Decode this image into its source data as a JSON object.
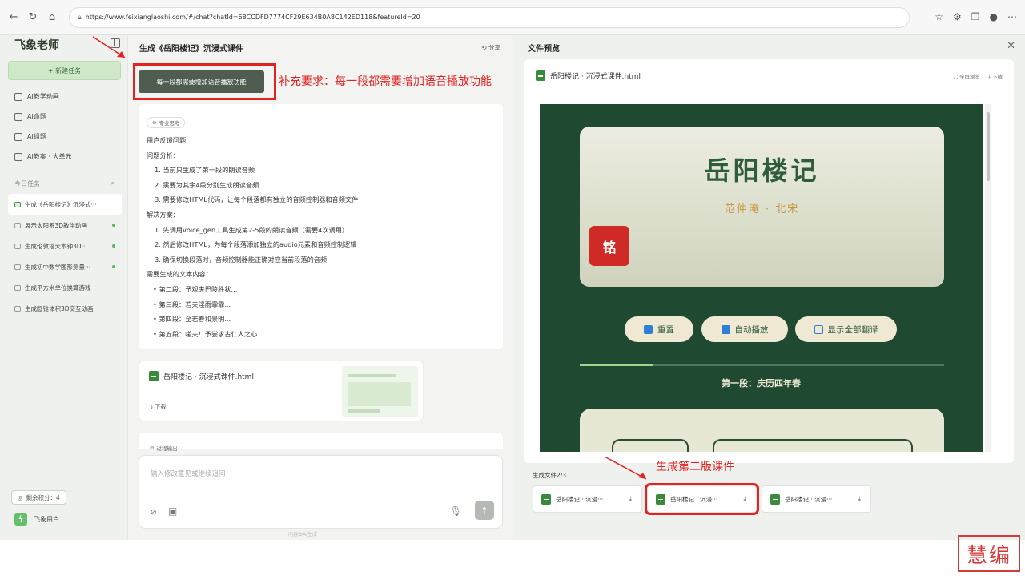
{
  "browser": {
    "url": "https://www.feixianglaoshi.com/#/chat?chatId=68CCDFD7774CF29E634B0A8C142ED118&featureId=20"
  },
  "sidebar": {
    "logo": "飞象老师",
    "new_task": "+ 新建任务",
    "menu": [
      {
        "label": "AI教学动画"
      },
      {
        "label": "AI命题"
      },
      {
        "label": "AI组题"
      },
      {
        "label": "AI教案 · 大单元"
      }
    ],
    "today_label": "今日任务",
    "tasks": [
      {
        "label": "生成《岳阳楼记》沉浸式···",
        "active": true
      },
      {
        "label": "展示太阳系3D教学动画",
        "dot": true
      },
      {
        "label": "生成伦敦塔大本钟3D···",
        "dot": true
      },
      {
        "label": "生成初中数学图形测量···",
        "dot": true
      },
      {
        "label": "生成平方米单位换算游戏"
      },
      {
        "label": "生成圆锥体积3D交互动画"
      }
    ],
    "points": "剩余积分：4",
    "user": "飞象用户"
  },
  "chat": {
    "title": "生成《岳阳楼记》沉浸式课件",
    "share": "分享",
    "user_msg": "每一段都需要增加语音播放功能",
    "annotation_top": "补充要求：每一段都需要增加语音播放功能",
    "thinking_label": "专业思考",
    "lines": [
      {
        "text": "用户反馈问题",
        "cls": ""
      },
      {
        "text": "问题分析：",
        "cls": ""
      },
      {
        "text": "1. 当前只生成了第一段的朗读音频",
        "cls": "ind"
      },
      {
        "text": "2. 需要为其余4段分别生成朗读音频",
        "cls": "ind"
      },
      {
        "text": "3. 需要修改HTML代码，让每个段落都有独立的音频控制器和音频文件",
        "cls": "ind"
      },
      {
        "text": "解决方案：",
        "cls": ""
      },
      {
        "text": "1. 先调用voice_gen工具生成第2-5段的朗读音频（需要4次调用）",
        "cls": "ind"
      },
      {
        "text": "2. 然后修改HTML，为每个段落添加独立的audio元素和音频控制逻辑",
        "cls": "ind"
      },
      {
        "text": "3. 确保切换段落时，音频控制器能正确对应当前段落的音频",
        "cls": "ind"
      },
      {
        "text": "需要生成的文本内容：",
        "cls": ""
      },
      {
        "text": "第二段：予观夫巴陵胜状...",
        "cls": "bul"
      },
      {
        "text": "第三段：若夫淫雨霏霏...",
        "cls": "bul"
      },
      {
        "text": "第四段：至若春和景明...",
        "cls": "bul"
      },
      {
        "text": "第五段：嗟夫！予尝求古仁人之心...",
        "cls": "bul"
      }
    ],
    "file_name": "岳阳楼记 · 沉浸式课件.html",
    "download": "下载",
    "process_label": "过程输出",
    "input_placeholder": "输入修改意见或继续追问",
    "ai_note": "内容由AI生成"
  },
  "preview": {
    "title": "文件预览",
    "file_name": "岳阳楼记 · 沉浸式课件.html",
    "fullscreen": "全屏浏览",
    "download": "下载",
    "hero_title": "岳阳楼记",
    "hero_sub": "范仲淹 · 北宋",
    "seal": "铭",
    "controls": {
      "reset": "重置",
      "autoplay": "自动播放",
      "translate": "显示全部翻译"
    },
    "progress": 0.2,
    "segment_title": "第一段：庆历四年春",
    "gen_label": "生成文件2/3",
    "gen_files": [
      {
        "label": "岳阳楼记 · 沉浸···"
      },
      {
        "label": "岳阳楼记 · 沉浸···",
        "selected": true
      },
      {
        "label": "岳阳楼记 · 沉浸···"
      }
    ],
    "annotation_bottom": "生成第二版课件"
  },
  "watermark": "慧编"
}
